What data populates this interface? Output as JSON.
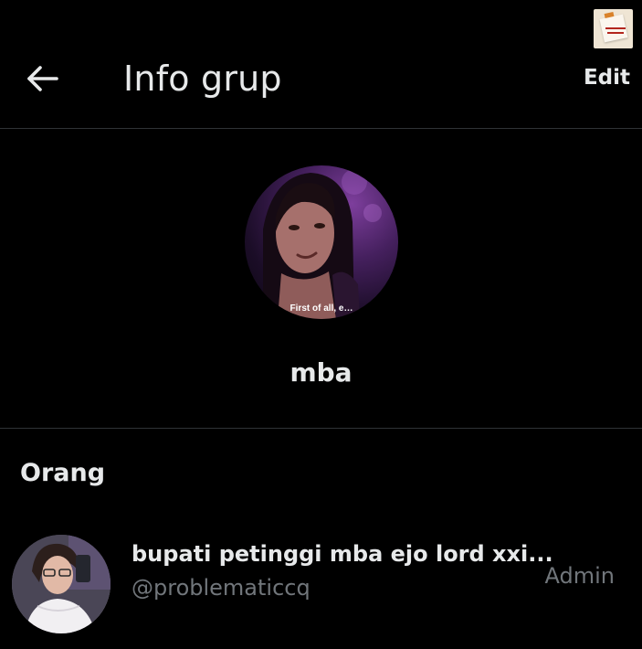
{
  "header": {
    "title": "Info grup",
    "edit_label": "Edit",
    "back_icon": "arrow-left-icon"
  },
  "group": {
    "name": "mba",
    "avatar_caption": "First of all, e…"
  },
  "people": {
    "heading": "Orang",
    "members": [
      {
        "display_name": "bupati petinggi mba ejo lord xxi...",
        "handle": "@problematiccq",
        "role": "Admin"
      }
    ]
  },
  "colors": {
    "background": "#000000",
    "primary_text": "#e7e9ea",
    "secondary_text": "#71767b",
    "divider": "#2f3336"
  }
}
